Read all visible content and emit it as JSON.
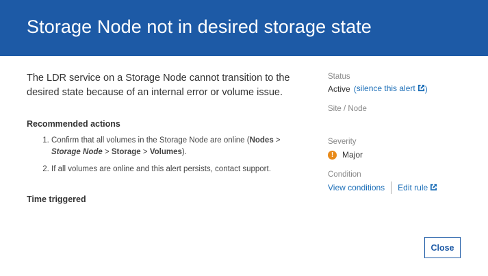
{
  "dialog": {
    "title": "Storage Node not in desired storage state",
    "description": "The LDR service on a Storage Node cannot transition to the desired state because of an internal error or volume issue.",
    "recommended_actions_title": "Recommended actions",
    "actions": {
      "step1": {
        "text_before": "Confirm that all volumes in the Storage Node are online (",
        "nodes": "Nodes",
        "sep1": " > ",
        "storage_node": "Storage Node",
        "sep2": " > ",
        "storage": "Storage",
        "sep3": " > ",
        "volumes": "Volumes",
        "text_after": ")."
      },
      "step2": "If all volumes are online and this alert persists, contact support."
    },
    "time_triggered_title": "Time triggered",
    "close_label": "Close"
  },
  "sidebar": {
    "status_label": "Status",
    "status_value": "Active",
    "silence_open": "(",
    "silence_link": "silence this alert",
    "silence_close": ")",
    "site_node_label": "Site / Node",
    "severity_label": "Severity",
    "severity_icon_symbol": "!",
    "severity_value": "Major",
    "condition_label": "Condition",
    "view_conditions_link": "View conditions",
    "edit_rule_link": "Edit rule"
  },
  "colors": {
    "header": "#1d5aa6",
    "link": "#1d6fb8",
    "severity_major": "#e88a1a"
  },
  "icons": {
    "external_link": "external-link-icon",
    "severity": "warning-icon"
  }
}
